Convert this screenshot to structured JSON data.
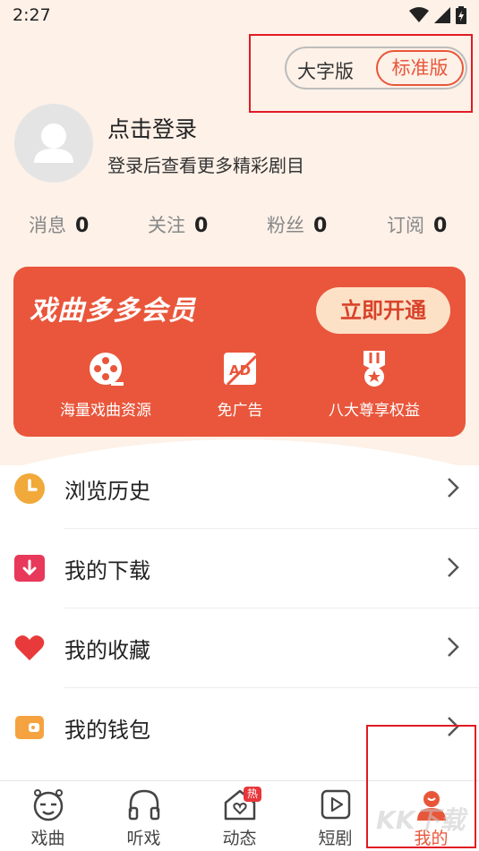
{
  "status_bar": {
    "time": "2:27"
  },
  "version_toggle": {
    "large": "大字版",
    "standard": "标准版",
    "selected": "标准版"
  },
  "profile": {
    "title": "点击登录",
    "subtitle": "登录后查看更多精彩剧目"
  },
  "stats": [
    {
      "label": "消息",
      "value": "0"
    },
    {
      "label": "关注",
      "value": "0"
    },
    {
      "label": "粉丝",
      "value": "0"
    },
    {
      "label": "订阅",
      "value": "0"
    }
  ],
  "vip": {
    "title": "戏曲多多会员",
    "button": "立即开通",
    "perks": [
      {
        "label": "海量戏曲资源",
        "icon": "film-reel-icon"
      },
      {
        "label": "免广告",
        "icon": "no-ad-icon"
      },
      {
        "label": "八大尊享权益",
        "icon": "medal-icon"
      }
    ]
  },
  "menu": [
    {
      "label": "浏览历史",
      "icon": "clock-icon",
      "color": "#f1a93a"
    },
    {
      "label": "我的下载",
      "icon": "download-icon",
      "color": "#e8395a"
    },
    {
      "label": "我的收藏",
      "icon": "heart-icon",
      "color": "#e83a3a"
    },
    {
      "label": "我的钱包",
      "icon": "wallet-icon",
      "color": "#f5a340"
    }
  ],
  "bottom_nav": [
    {
      "label": "戏曲",
      "icon": "opera-mask-icon"
    },
    {
      "label": "听戏",
      "icon": "headphones-icon"
    },
    {
      "label": "动态",
      "icon": "house-heart-icon",
      "badge": "热"
    },
    {
      "label": "短剧",
      "icon": "play-square-icon"
    },
    {
      "label": "我的",
      "icon": "profile-icon",
      "active": true
    }
  ],
  "accent_color": "#e8563a",
  "watermark": "KK下载"
}
